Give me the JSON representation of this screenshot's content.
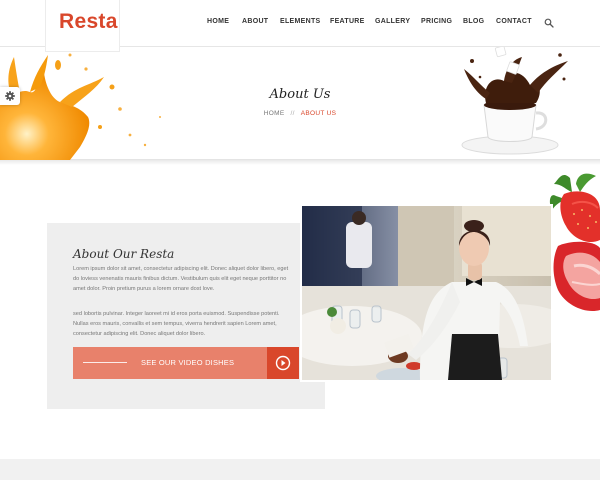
{
  "brand": {
    "logo_text": "Resta",
    "accent": "#d9472b",
    "button_color": "#e8816b"
  },
  "nav": {
    "items": [
      {
        "label": "HOME"
      },
      {
        "label": "ABOUT"
      },
      {
        "label": "ELEMENTS"
      },
      {
        "label": "FEATURE"
      },
      {
        "label": "GALLERY"
      },
      {
        "label": "PRICING"
      },
      {
        "label": "BLOG"
      },
      {
        "label": "CONTACT"
      }
    ],
    "search_icon": "search-icon"
  },
  "settings": {
    "icon": "gear-icon"
  },
  "banner": {
    "title": "About Us",
    "breadcrumb": {
      "home": "HOME",
      "separator": "//",
      "current": "ABOUT US"
    },
    "left_image": "orange-juice-splash",
    "right_image": "coffee-cup-splash"
  },
  "about": {
    "title": "About Our Resta",
    "paragraph1": "Lorem ipsum dolor sit amet, consectetur adipiscing elit. Donec aliquet dolor libero, eget do loviess venenatis mauris finibus dictum. Vestibulum quis elit eget neque porttitor no amet dolor. Proin pretium purus a lorem ornare dost love.",
    "paragraph2": "sed lobortis pulvinar. Integer laoreet mi id eros porta euismod. Suspendisse potenti. Nullas eros mauris, convallis et sem tempus, viverra hendrerit sapien Lorem amet, consectetur adipiscing elit. Donec aliquet dolor libero.",
    "cta_label": "SEE OUR VIDEO DISHES",
    "cta_icon": "play-icon",
    "photo": "waitress-serving-banquet",
    "decor": "strawberry"
  }
}
